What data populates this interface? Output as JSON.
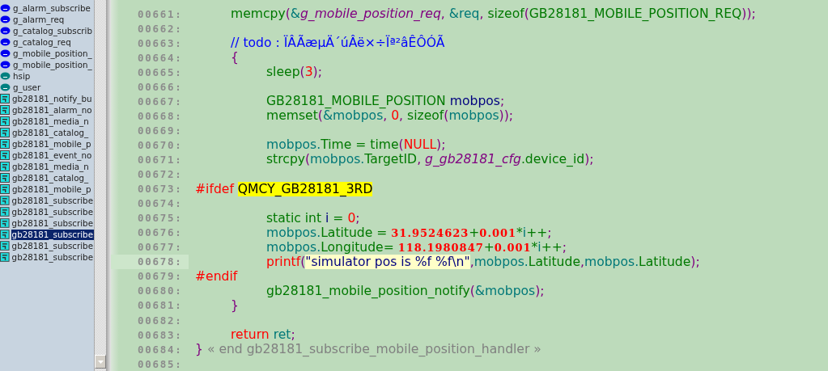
{
  "symbols": [
    {
      "kind": "variable",
      "label": "g_alarm_subscribe",
      "selected": false
    },
    {
      "kind": "variable",
      "label": "g_alarm_req",
      "selected": false
    },
    {
      "kind": "variable",
      "label": "g_catalog_subscrib",
      "selected": false
    },
    {
      "kind": "variable",
      "label": "g_catalog_req",
      "selected": false
    },
    {
      "kind": "variable",
      "label": "g_mobile_position_",
      "selected": false
    },
    {
      "kind": "variable",
      "label": "g_mobile_position_",
      "selected": false
    },
    {
      "kind": "static",
      "label": "hsip",
      "selected": false
    },
    {
      "kind": "static",
      "label": "g_user",
      "selected": false
    },
    {
      "kind": "function",
      "label": "gb28181_notify_bu",
      "selected": false
    },
    {
      "kind": "function",
      "label": "gb28181_alarm_no",
      "selected": false
    },
    {
      "kind": "function",
      "label": "gb28181_media_n",
      "selected": false
    },
    {
      "kind": "function",
      "label": "gb28181_catalog_",
      "selected": false
    },
    {
      "kind": "function",
      "label": "gb28181_mobile_p",
      "selected": false
    },
    {
      "kind": "function",
      "label": "gb28181_event_no",
      "selected": false
    },
    {
      "kind": "function",
      "label": "gb28181_media_n",
      "selected": false
    },
    {
      "kind": "function",
      "label": "gb28181_catalog_",
      "selected": false
    },
    {
      "kind": "function",
      "label": "gb28181_mobile_p",
      "selected": false
    },
    {
      "kind": "function",
      "label": "gb28181_subscribe",
      "selected": false
    },
    {
      "kind": "function",
      "label": "gb28181_subscribe",
      "selected": false
    },
    {
      "kind": "function",
      "label": "gb28181_subscribe",
      "selected": false
    },
    {
      "kind": "function",
      "label": "gb28181_subscribe",
      "selected": true
    },
    {
      "kind": "function",
      "label": "gb28181_subscribe",
      "selected": false
    },
    {
      "kind": "function",
      "label": "gb28181_subscribe",
      "selected": false
    }
  ],
  "code_lines": [
    {
      "number": "00661:",
      "current": false,
      "tokens": [
        {
          "kind": "fn",
          "text": "\tmemcpy"
        },
        {
          "kind": "punct",
          "text": "("
        },
        {
          "kind": "var",
          "text": "&"
        },
        {
          "kind": "global",
          "text": "g_mobile_position_req"
        },
        {
          "kind": "punct",
          "text": ", "
        },
        {
          "kind": "var",
          "text": "&req"
        },
        {
          "kind": "punct",
          "text": ", "
        },
        {
          "kind": "fn",
          "text": "sizeof"
        },
        {
          "kind": "punct",
          "text": "("
        },
        {
          "kind": "fn",
          "text": "GB28181_MOBILE_POSITION_REQ"
        },
        {
          "kind": "punct",
          "text": "));"
        }
      ]
    },
    {
      "number": "00662:",
      "current": false
    },
    {
      "number": "00663:",
      "current": false,
      "tokens": [
        {
          "kind": "comment",
          "text": "\t// todo : ÏÂÃæµÄ´úÂë×÷Ïª²âÊÔÓÃ"
        }
      ]
    },
    {
      "number": "00664:",
      "current": false,
      "tokens": [
        {
          "kind": "punct",
          "text": "\t{"
        }
      ]
    },
    {
      "number": "00665:",
      "current": false,
      "tokens": [
        {
          "kind": "fn",
          "text": "\t\tsleep"
        },
        {
          "kind": "punct",
          "text": "("
        },
        {
          "kind": "num",
          "text": "3"
        },
        {
          "kind": "punct",
          "text": ");"
        }
      ]
    },
    {
      "number": "00666:",
      "current": false
    },
    {
      "number": "00667:",
      "current": false,
      "tokens": [
        {
          "kind": "fn",
          "text": "\t\tGB28181_MOBILE_POSITION "
        },
        {
          "kind": "type",
          "text": "mobpos"
        },
        {
          "kind": "punct",
          "text": ";"
        }
      ]
    },
    {
      "number": "00668:",
      "current": false,
      "tokens": [
        {
          "kind": "fn",
          "text": "\t\tmemset"
        },
        {
          "kind": "punct",
          "text": "("
        },
        {
          "kind": "var",
          "text": "&mobpos"
        },
        {
          "kind": "punct",
          "text": ", "
        },
        {
          "kind": "num",
          "text": "0"
        },
        {
          "kind": "punct",
          "text": ", "
        },
        {
          "kind": "fn",
          "text": "sizeof"
        },
        {
          "kind": "punct",
          "text": "("
        },
        {
          "kind": "var",
          "text": "mobpos"
        },
        {
          "kind": "punct",
          "text": "));"
        }
      ]
    },
    {
      "number": "00669:",
      "current": false
    },
    {
      "number": "00670:",
      "current": false,
      "tokens": [
        {
          "kind": "var",
          "text": "\t\tmobpos."
        },
        {
          "kind": "fn",
          "text": "Time = time"
        },
        {
          "kind": "punct",
          "text": "("
        },
        {
          "kind": "num",
          "text": "NULL"
        },
        {
          "kind": "punct",
          "text": ");"
        }
      ]
    },
    {
      "number": "00671:",
      "current": false,
      "tokens": [
        {
          "kind": "fn",
          "text": "\t\tstrcpy"
        },
        {
          "kind": "punct",
          "text": "("
        },
        {
          "kind": "var",
          "text": "mobpos."
        },
        {
          "kind": "fn",
          "text": "TargetID"
        },
        {
          "kind": "punct",
          "text": ", "
        },
        {
          "kind": "global",
          "text": "g_gb28181_cfg"
        },
        {
          "kind": "fn",
          "text": ".device_id"
        },
        {
          "kind": "punct",
          "text": ");"
        }
      ]
    },
    {
      "number": "00672:",
      "current": false
    },
    {
      "number": "00673:",
      "current": false,
      "tokens": [
        {
          "kind": "pre",
          "text": "#ifdef "
        },
        {
          "kind": "macro",
          "text": "QMCY_GB28181_3RD"
        }
      ]
    },
    {
      "number": "00674:",
      "current": false
    },
    {
      "number": "00675:",
      "current": false,
      "tokens": [
        {
          "kind": "fn",
          "text": "\t\tstatic int "
        },
        {
          "kind": "type",
          "text": "i"
        },
        {
          "kind": "fn",
          "text": " = "
        },
        {
          "kind": "num",
          "text": "0"
        },
        {
          "kind": "punct",
          "text": ";"
        }
      ]
    },
    {
      "number": "00676:",
      "current": false,
      "tokens": [
        {
          "kind": "var",
          "text": "\t\tmobpos."
        },
        {
          "kind": "fn",
          "text": "Latitude = "
        },
        {
          "kind": "float",
          "text": "31.9524623"
        },
        {
          "kind": "fn",
          "text": "+"
        },
        {
          "kind": "float",
          "text": "0.001"
        },
        {
          "kind": "fn",
          "text": "*"
        },
        {
          "kind": "var",
          "text": "i"
        },
        {
          "kind": "fn",
          "text": "++"
        },
        {
          "kind": "punct",
          "text": ";"
        }
      ]
    },
    {
      "number": "00677:",
      "current": false,
      "tokens": [
        {
          "kind": "var",
          "text": "\t\tmobpos."
        },
        {
          "kind": "fn",
          "text": "Longitude= "
        },
        {
          "kind": "float",
          "text": "118.1980847"
        },
        {
          "kind": "fn",
          "text": "+"
        },
        {
          "kind": "float",
          "text": "0.001"
        },
        {
          "kind": "fn",
          "text": "*"
        },
        {
          "kind": "var",
          "text": "i"
        },
        {
          "kind": "fn",
          "text": "++"
        },
        {
          "kind": "punct",
          "text": ";"
        }
      ]
    },
    {
      "number": "00678:",
      "current": true,
      "tokens": [
        {
          "kind": "keyword",
          "text": "\t\tprintf"
        },
        {
          "kind": "punct",
          "text": "("
        },
        {
          "kind": "string",
          "text": "\"simulator pos is %f %f\\n\""
        },
        {
          "kind": "punct",
          "text": ","
        },
        {
          "kind": "var",
          "text": "mobpos."
        },
        {
          "kind": "fn",
          "text": "Latitude"
        },
        {
          "kind": "punct",
          "text": ","
        },
        {
          "kind": "var",
          "text": "mobpos."
        },
        {
          "kind": "fn",
          "text": "Latitude"
        },
        {
          "kind": "punct",
          "text": ");"
        }
      ]
    },
    {
      "number": "00679:",
      "current": false,
      "tokens": [
        {
          "kind": "pre",
          "text": "#endif"
        }
      ]
    },
    {
      "number": "00680:",
      "current": false,
      "tokens": [
        {
          "kind": "fn",
          "text": "\t\tgb28181_mobile_position_notify"
        },
        {
          "kind": "punct",
          "text": "("
        },
        {
          "kind": "var",
          "text": "&mobpos"
        },
        {
          "kind": "punct",
          "text": ");"
        }
      ]
    },
    {
      "number": "00681:",
      "current": false,
      "tokens": [
        {
          "kind": "punct",
          "text": "\t}"
        }
      ]
    },
    {
      "number": "00682:",
      "current": false
    },
    {
      "number": "00683:",
      "current": false,
      "tokens": [
        {
          "kind": "keyword",
          "text": "\treturn "
        },
        {
          "kind": "var",
          "text": "ret"
        },
        {
          "kind": "punct",
          "text": ";"
        }
      ]
    },
    {
      "number": "00684:",
      "current": false,
      "tokens": [
        {
          "kind": "punct",
          "text": "} "
        },
        {
          "kind": "endnote",
          "text": "« end gb28181_subscribe_mobile_position_handler »"
        }
      ]
    },
    {
      "number": "00685:",
      "current": false
    }
  ]
}
